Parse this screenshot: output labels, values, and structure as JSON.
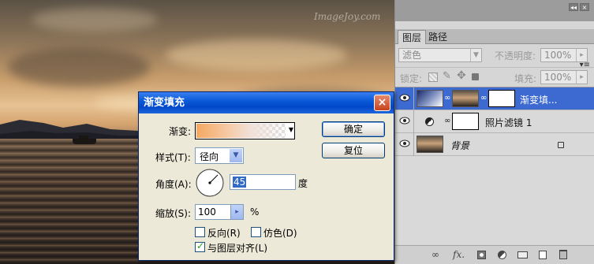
{
  "canvas": {
    "watermark": "ImageJoy.com"
  },
  "panel": {
    "tabs": [
      {
        "label": "图层"
      },
      {
        "label": "路径"
      }
    ],
    "menu_icon": "panel-menu-icon",
    "blend_mode": "滤色",
    "opacity_label": "不透明度:",
    "opacity_value": "100%",
    "lock_label": "锁定:",
    "fill_label": "填充:",
    "fill_value": "100%",
    "layers": [
      {
        "name": "渐变填...",
        "active": true
      },
      {
        "name": "照片滤镜 1",
        "active": false
      },
      {
        "name": "背景",
        "active": false
      }
    ],
    "footer_icons": [
      "link-icon",
      "fx-icon",
      "mask-icon",
      "adjustment-icon",
      "group-icon",
      "new-layer-icon",
      "trash-icon"
    ],
    "footer_fx": "fx."
  },
  "dialog": {
    "title": "渐变填充",
    "gradient_label": "渐变:",
    "style_label": "样式(T):",
    "style_value": "径向",
    "angle_label": "角度(A):",
    "angle_value": "45",
    "angle_unit": "度",
    "scale_label": "缩放(S):",
    "scale_value": "100",
    "scale_unit": "%",
    "reverse_label": "反向(R)",
    "dither_label": "仿色(D)",
    "align_label": "与图层对齐(L)",
    "reverse_checked": false,
    "dither_checked": false,
    "align_checked": true,
    "ok_label": "确定",
    "reset_label": "复位",
    "close_label": "×"
  }
}
